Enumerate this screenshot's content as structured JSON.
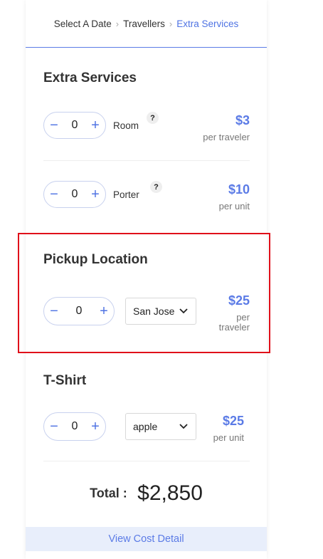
{
  "breadcrumb": {
    "items": [
      "Select A Date",
      "Travellers",
      "Extra Services"
    ]
  },
  "extra_services": {
    "title": "Extra Services",
    "items": [
      {
        "quantity": "0",
        "label": "Room",
        "help": "?",
        "price": "$3",
        "unit": "per traveler"
      },
      {
        "quantity": "0",
        "label": "Porter",
        "help": "?",
        "price": "$10",
        "unit": "per unit"
      }
    ]
  },
  "pickup_location": {
    "title": "Pickup Location",
    "quantity": "0",
    "selected_option": "San Jose",
    "price": "$25",
    "unit_line1": "per",
    "unit_line2": "traveler"
  },
  "tshirt": {
    "title": "T-Shirt",
    "quantity": "0",
    "selected_option": "apple",
    "price": "$25",
    "unit": "per unit"
  },
  "total": {
    "label": "Total :",
    "amount": "$2,850"
  },
  "view_cost_detail": "View Cost Detail",
  "icons": {
    "minus": "−",
    "plus": "+"
  },
  "colors": {
    "accent": "#5b7be6",
    "highlight": "#e0101a"
  }
}
